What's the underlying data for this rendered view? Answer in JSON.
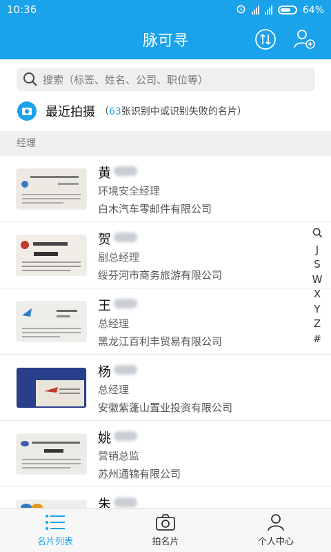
{
  "status_bar": {
    "time": "10:36",
    "battery": "64%"
  },
  "header": {
    "title": "脉可寻",
    "sort_icon": "sort-arrows-icon",
    "add_contact_icon": "add-person-icon"
  },
  "search": {
    "placeholder": "搜索（标签、姓名、公司、职位等）"
  },
  "recent": {
    "title": "最近拍摄",
    "note_open": "（",
    "count": "63",
    "note_rest": "张识别中或识别失败的名片）"
  },
  "section": {
    "label": "经理"
  },
  "contacts": [
    {
      "surname": "黄",
      "title": "环境安全经理",
      "company": "白木汽车零邮件有限公司"
    },
    {
      "surname": "贺",
      "title": "副总经理",
      "company": "绥芬河市商务旅游有限公司"
    },
    {
      "surname": "王",
      "title": "总经理",
      "company": "黑龙江百利丰贸易有限公司"
    },
    {
      "surname": "杨",
      "title": "总经理",
      "company": "安徽紫蓬山置业投资有限公司"
    },
    {
      "surname": "姚",
      "title": "营销总监",
      "company": "苏州通锦有限公司"
    },
    {
      "surname": "朱",
      "title": "",
      "company": ""
    }
  ],
  "alpha_index": [
    "J",
    "S",
    "W",
    "X",
    "Y",
    "Z",
    "#"
  ],
  "bottom_nav": {
    "list": "名片列表",
    "scan": "拍名片",
    "profile": "个人中心"
  },
  "colors": {
    "accent": "#1aa2ea"
  }
}
